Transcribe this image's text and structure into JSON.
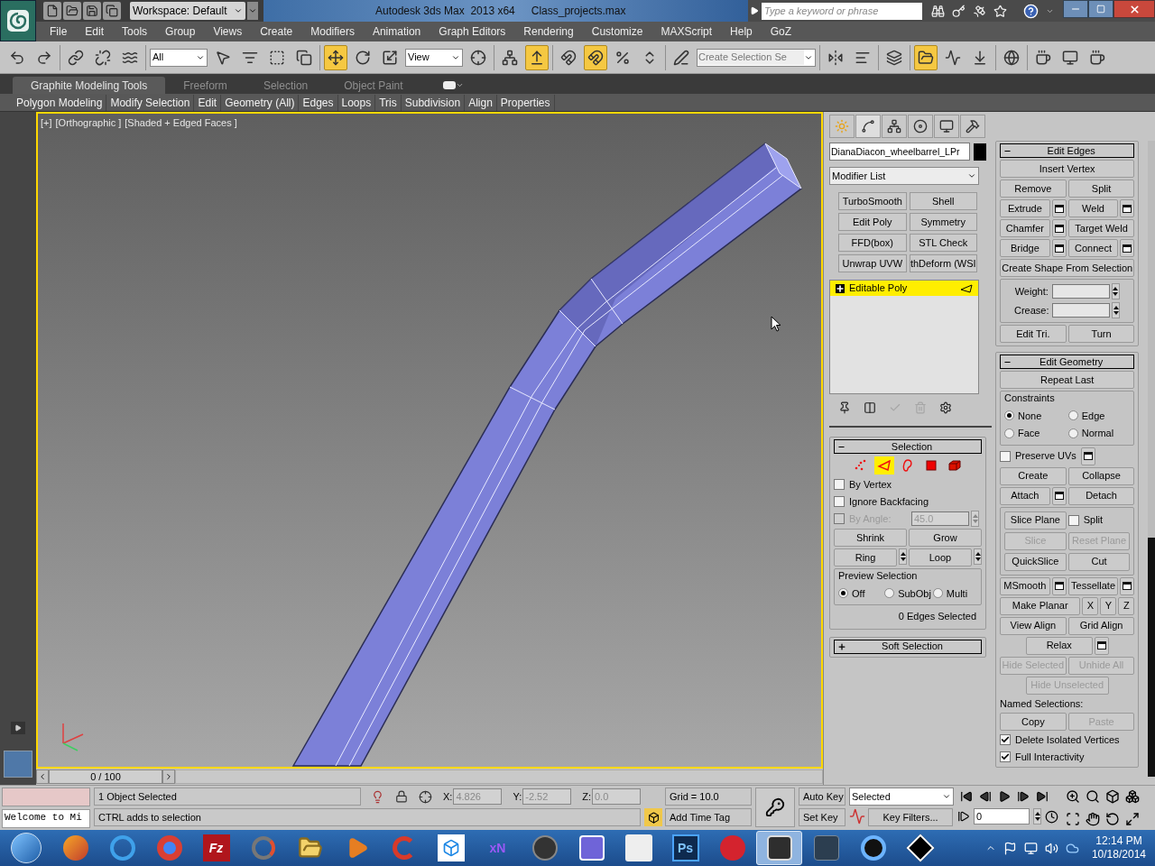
{
  "title_bar": {
    "workspace": "Workspace: Default",
    "app_title": "Autodesk 3ds Max  2013 x64",
    "file_name": "Class_projects.max",
    "search": {
      "placeholder": "Type a keyword or phrase"
    }
  },
  "menu_bar": [
    "File",
    "Edit",
    "Tools",
    "Group",
    "Views",
    "Create",
    "Modifiers",
    "Animation",
    "Graph Editors",
    "Rendering",
    "Customize",
    "MAXScript",
    "Help",
    "GoZ"
  ],
  "main_toolbar": {
    "groups": [
      [
        {
          "kind": "button",
          "active": false
        },
        {
          "kind": "button",
          "active": false
        }
      ],
      [
        {
          "kind": "button",
          "active": false
        },
        {
          "kind": "button",
          "active": false
        },
        {
          "kind": "button",
          "active": false
        }
      ],
      [
        {
          "kind": "dropdown",
          "value": "All"
        },
        {
          "kind": "button",
          "active": false
        },
        {
          "kind": "button",
          "active": false
        },
        {
          "kind": "button",
          "active": false
        },
        {
          "kind": "button",
          "active": false
        }
      ],
      [
        {
          "kind": "button",
          "active": true
        },
        {
          "kind": "button",
          "active": false
        },
        {
          "kind": "button",
          "active": false
        },
        {
          "kind": "dropdown",
          "value": "View"
        },
        {
          "kind": "button",
          "active": false
        }
      ],
      [
        {
          "kind": "button",
          "active": false
        },
        {
          "kind": "button",
          "active": true
        }
      ],
      [
        {
          "kind": "button",
          "active": false
        },
        {
          "kind": "button",
          "active": true
        },
        {
          "kind": "button",
          "active": false
        },
        {
          "kind": "button",
          "active": false
        }
      ],
      [
        {
          "kind": "button",
          "active": false
        },
        {
          "kind": "field",
          "placeholder": "Create Selection Se"
        }
      ],
      [
        {
          "kind": "button",
          "active": false
        },
        {
          "kind": "button",
          "active": false
        }
      ],
      [
        {
          "kind": "button",
          "active": false
        }
      ],
      [
        {
          "kind": "button",
          "active": true
        },
        {
          "kind": "button",
          "active": false
        },
        {
          "kind": "button",
          "active": false
        }
      ],
      [
        {
          "kind": "button",
          "active": false
        }
      ],
      [
        {
          "kind": "button",
          "active": false
        },
        {
          "kind": "button",
          "active": false
        },
        {
          "kind": "button",
          "active": false
        }
      ]
    ]
  },
  "ribbon": {
    "tabs": [
      {
        "label": "Graphite Modeling Tools",
        "selected": true
      },
      {
        "label": "Freeform",
        "selected": false
      },
      {
        "label": "Selection",
        "selected": false
      },
      {
        "label": "Object Paint",
        "selected": false
      }
    ],
    "panels": [
      "Polygon Modeling",
      "Modify Selection",
      "Edit",
      "Geometry (All)",
      "Edges",
      "Loops",
      "Tris",
      "Subdivision",
      "Align",
      "Properties"
    ]
  },
  "viewport": {
    "active": true,
    "labels": [
      "[+]",
      "[Orthographic ]",
      "[Shaded + Edged Faces ]"
    ]
  },
  "time_slider": {
    "frame": "0 / 100"
  },
  "command_panel": {
    "tabs": [
      {
        "selected": false
      },
      {
        "selected": true
      },
      {
        "selected": false
      },
      {
        "selected": false
      },
      {
        "selected": false
      },
      {
        "selected": false
      }
    ],
    "object_name": "DianaDiacon_wheelbarrel_LPr",
    "modifier_list": "Modifier List",
    "modifier_buttons": [
      "TurboSmooth",
      "Shell",
      "Edit Poly",
      "Symmetry",
      "FFD(box)",
      "STL Check",
      "Unwrap UVW",
      "thDeform (WSI"
    ],
    "stack": [
      {
        "name": "Editable Poly",
        "selected": true
      }
    ],
    "stack_tools": [
      {
        "disabled": false
      },
      {
        "disabled": false
      },
      {
        "disabled": true
      },
      {
        "disabled": true
      },
      {
        "disabled": false
      }
    ],
    "rollouts_left": [
      {
        "title": "Selection",
        "expanded": true,
        "levels": [
          {
            "selected": false
          },
          {
            "selected": true
          },
          {
            "selected": false
          },
          {
            "selected": false
          },
          {
            "selected": false
          }
        ],
        "rows": [
          [
            {
              "kind": "checkbox",
              "label": "By Vertex",
              "checked": false,
              "disabled": false
            }
          ],
          [
            {
              "kind": "checkbox",
              "label": "Ignore Backfacing",
              "checked": false,
              "disabled": false
            }
          ],
          [
            {
              "kind": "checkbox",
              "label": "By Angle:",
              "checked": false,
              "disabled": true
            },
            {
              "kind": "spinner",
              "value": "45.0",
              "disabled": true
            }
          ],
          [
            {
              "kind": "button",
              "label": "Shrink",
              "disabled": false
            },
            {
              "kind": "button",
              "label": "Grow",
              "disabled": false
            }
          ],
          [
            {
              "kind": "button",
              "label": "Ring",
              "disabled": false,
              "spinner": true
            },
            {
              "kind": "button",
              "label": "Loop",
              "disabled": false,
              "spinner": true
            }
          ],
          [
            {
              "kind": "group",
              "title": "Preview Selection",
              "rows": [
                [
                  {
                    "kind": "radio",
                    "label": "Off",
                    "selected": true
                  },
                  {
                    "kind": "radio",
                    "label": "SubObj",
                    "selected": false
                  },
                  {
                    "kind": "radio",
                    "label": "Multi",
                    "selected": false
                  }
                ]
              ]
            }
          ],
          [
            {
              "kind": "status",
              "label": "0 Edges Selected"
            }
          ]
        ]
      },
      {
        "title": "Soft Selection",
        "expanded": false
      }
    ],
    "rollouts_right": [
      {
        "title": "Edit Edges",
        "expanded": true,
        "rows": [
          [
            {
              "kind": "wide_button",
              "label": "Insert Vertex",
              "disabled": false
            }
          ],
          [
            {
              "kind": "button",
              "label": "Remove",
              "disabled": false
            },
            {
              "kind": "button",
              "label": "Split",
              "disabled": false
            }
          ],
          [
            {
              "kind": "button",
              "label": "Extrude",
              "disabled": false,
              "settings": true
            },
            {
              "kind": "button",
              "label": "Weld",
              "disabled": false,
              "settings": true
            }
          ],
          [
            {
              "kind": "button",
              "label": "Chamfer",
              "disabled": false,
              "settings": true
            },
            {
              "kind": "button",
              "label": "Target Weld",
              "disabled": false
            }
          ],
          [
            {
              "kind": "button",
              "label": "Bridge",
              "disabled": false,
              "settings": true
            },
            {
              "kind": "button",
              "label": "Connect",
              "disabled": false,
              "settings": true
            }
          ],
          [
            {
              "kind": "wide_button",
              "label": "Create Shape From Selection",
              "disabled": false
            }
          ],
          [
            {
              "kind": "group",
              "rows": [
                [
                  {
                    "kind": "spinner",
                    "label": "Weight:",
                    "disabled": false
                  }
                ],
                [
                  {
                    "kind": "spinner",
                    "label": "Crease:",
                    "disabled": false
                  }
                ]
              ]
            }
          ],
          [
            {
              "kind": "button",
              "label": "Edit Tri.",
              "disabled": false
            },
            {
              "kind": "button",
              "label": "Turn",
              "disabled": false
            }
          ]
        ]
      },
      {
        "title": "Edit Geometry",
        "expanded": true,
        "rows": [
          [
            {
              "kind": "wide_button",
              "label": "Repeat Last",
              "disabled": false
            }
          ],
          [
            {
              "kind": "group",
              "title": "Constraints",
              "rows": [
                [
                  {
                    "kind": "radio",
                    "label": "None",
                    "selected": true
                  },
                  {
                    "kind": "radio",
                    "label": "Edge",
                    "selected": false
                  }
                ],
                [
                  {
                    "kind": "radio",
                    "label": "Face",
                    "selected": false
                  },
                  {
                    "kind": "radio",
                    "label": "Normal",
                    "selected": false
                  }
                ]
              ]
            }
          ],
          [
            {
              "kind": "checkbox",
              "label": "Preserve UVs",
              "checked": false,
              "disabled": false,
              "settings": true
            }
          ],
          [
            {
              "kind": "button",
              "label": "Create",
              "disabled": false
            },
            {
              "kind": "button",
              "label": "Collapse",
              "disabled": false
            }
          ],
          [
            {
              "kind": "button",
              "label": "Attach",
              "disabled": false,
              "settings": true
            },
            {
              "kind": "button",
              "label": "Detach",
              "disabled": false
            }
          ],
          [
            {
              "kind": "group",
              "rows": [
                [
                  {
                    "kind": "button",
                    "label": "Slice Plane",
                    "disabled": false
                  },
                  {
                    "kind": "checkbox",
                    "label": "Split",
                    "checked": false,
                    "disabled": false
                  }
                ],
                [
                  {
                    "kind": "button",
                    "label": "Slice",
                    "disabled": true
                  },
                  {
                    "kind": "button",
                    "label": "Reset Plane",
                    "disabled": true
                  }
                ],
                [
                  {
                    "kind": "button",
                    "label": "QuickSlice",
                    "disabled": false
                  },
                  {
                    "kind": "button",
                    "label": "Cut",
                    "disabled": false
                  }
                ]
              ]
            }
          ],
          [
            {
              "kind": "button",
              "label": "MSmooth",
              "disabled": false,
              "settings": true
            },
            {
              "kind": "button",
              "label": "Tessellate",
              "disabled": false,
              "settings": true
            }
          ],
          [
            {
              "kind": "button",
              "label": "Make Planar",
              "disabled": false
            },
            {
              "kind": "axis_button",
              "label": "X",
              "disabled": false
            },
            {
              "kind": "axis_button",
              "label": "Y",
              "disabled": false
            },
            {
              "kind": "axis_button",
              "label": "Z",
              "disabled": false
            }
          ],
          [
            {
              "kind": "button",
              "label": "View Align",
              "disabled": false
            },
            {
              "kind": "button",
              "label": "Grid Align",
              "disabled": false
            }
          ],
          [
            {
              "kind": "button",
              "label": "Relax",
              "disabled": false,
              "settings": true
            }
          ],
          [
            {
              "kind": "button",
              "label": "Hide Selected",
              "disabled": true
            },
            {
              "kind": "button",
              "label": "Unhide All",
              "disabled": true
            }
          ],
          [
            {
              "kind": "button",
              "label": "Hide Unselected",
              "disabled": true
            }
          ],
          [
            {
              "kind": "text",
              "label": "Named Selections:"
            }
          ],
          [
            {
              "kind": "button",
              "label": "Copy",
              "disabled": false
            },
            {
              "kind": "button",
              "label": "Paste",
              "disabled": true
            }
          ],
          [
            {
              "kind": "checkbox",
              "label": "Delete Isolated Vertices",
              "checked": true,
              "disabled": false
            }
          ],
          [
            {
              "kind": "checkbox",
              "label": "Full Interactivity",
              "checked": true,
              "disabled": false
            }
          ]
        ]
      }
    ]
  },
  "status": {
    "listener_output": "Welcome to Mi",
    "selection_info": "1 Object Selected",
    "prompt": "CTRL adds to selection",
    "coords": [
      {
        "axis": "X:",
        "value": "4.826",
        "disabled": true
      },
      {
        "axis": "Y:",
        "value": "-2.52",
        "disabled": true
      },
      {
        "axis": "Z:",
        "value": "0.0",
        "disabled": true
      }
    ],
    "grid": "Grid = 10.0",
    "time_tag": "Add Time Tag",
    "auto_key": "Auto Key",
    "set_key": "Set Key",
    "key_mode": "Selected",
    "key_filters": "Key Filters...",
    "frame": "0"
  },
  "taskbar": {
    "apps": [
      {
        "active": false
      },
      {
        "active": false
      },
      {
        "active": false
      },
      {
        "active": false,
        "logo": "Fz"
      },
      {
        "active": false
      },
      {
        "active": false
      },
      {
        "active": false
      },
      {
        "active": false
      },
      {
        "active": false
      },
      {
        "active": false,
        "logo": "xN"
      },
      {
        "active": false
      },
      {
        "active": false
      },
      {
        "active": false
      },
      {
        "active": false,
        "logo": "Ps"
      },
      {
        "active": false
      },
      {
        "active": true
      },
      {
        "active": false
      },
      {
        "active": false
      },
      {
        "active": false
      }
    ],
    "time": "12:14 PM",
    "date": "10/18/2014"
  }
}
